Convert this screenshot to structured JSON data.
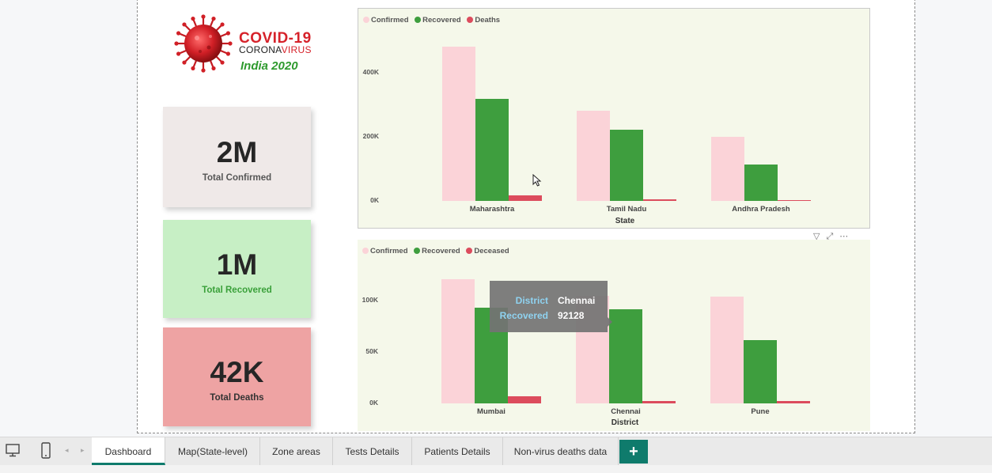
{
  "logo": {
    "title": "COVID-19",
    "subtitle_part1": "CORONA",
    "subtitle_part2": "VIRUS",
    "year": "India 2020"
  },
  "kpis": [
    {
      "value": "2M",
      "label": "Total Confirmed",
      "bg": "#efe9e8",
      "label_color": "#555555"
    },
    {
      "value": "1M",
      "label": "Total Recovered",
      "bg": "#c7efc5",
      "label_color": "#3aa03a"
    },
    {
      "value": "42K",
      "label": "Total Deaths",
      "bg": "#eea3a3",
      "label_color": "#333333"
    }
  ],
  "chart_data": [
    {
      "type": "bar",
      "xlabel": "State",
      "ylabel": "",
      "ylim": [
        0,
        500000
      ],
      "yticks": [
        "0K",
        "200K",
        "400K"
      ],
      "ytick_values": [
        0,
        200000,
        400000
      ],
      "categories": [
        "Maharashtra",
        "Tamil Nadu",
        "Andhra Pradesh"
      ],
      "series": [
        {
          "name": "Confirmed",
          "color": "#fbd3d8",
          "values": [
            480000,
            280000,
            200000
          ]
        },
        {
          "name": "Recovered",
          "color": "#3e9e3e",
          "values": [
            318000,
            222000,
            113000
          ]
        },
        {
          "name": "Deaths",
          "color": "#dc4c5d",
          "values": [
            17000,
            4500,
            1800
          ]
        }
      ],
      "legend": "top-left",
      "grid": false
    },
    {
      "type": "bar",
      "xlabel": "District",
      "ylabel": "",
      "ylim": [
        0,
        125000
      ],
      "yticks": [
        "0K",
        "50K",
        "100K"
      ],
      "ytick_values": [
        0,
        50000,
        100000
      ],
      "categories": [
        "Mumbai",
        "Chennai",
        "Pune"
      ],
      "series": [
        {
          "name": "Confirmed",
          "color": "#fbd3d8",
          "values": [
            121000,
            105000,
            104000
          ]
        },
        {
          "name": "Recovered",
          "color": "#3e9e3e",
          "values": [
            93000,
            92128,
            62000
          ]
        },
        {
          "name": "Deceased",
          "color": "#dc4c5d",
          "values": [
            6800,
            2100,
            2300
          ]
        }
      ],
      "legend": "top-left",
      "grid": false
    }
  ],
  "tooltip": {
    "district_key": "District",
    "district_value": "Chennai",
    "recovered_key": "Recovered",
    "recovered_value": "92128"
  },
  "tabs": [
    {
      "label": "Dashboard",
      "active": true
    },
    {
      "label": "Map(State-level)",
      "active": false
    },
    {
      "label": "Zone areas",
      "active": false
    },
    {
      "label": "Tests Details",
      "active": false
    },
    {
      "label": "Patients Details",
      "active": false
    },
    {
      "label": "Non-virus deaths data",
      "active": false
    }
  ],
  "add_tab_label": "+",
  "icons": {
    "desktop": "desktop-view-icon",
    "phone": "phone-view-icon",
    "prev": "prev-page-icon",
    "next": "next-page-icon",
    "filter": "filter-icon",
    "focus": "focus-mode-icon",
    "more": "more-options-icon",
    "cursor": "mouse-cursor-icon"
  }
}
